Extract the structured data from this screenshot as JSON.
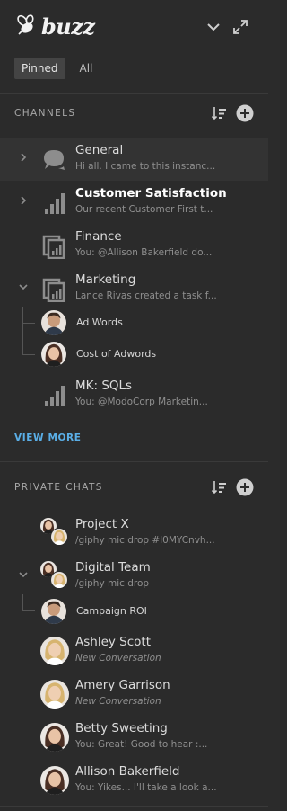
{
  "app": {
    "logo_text": "buzz"
  },
  "filters": {
    "pinned": "Pinned",
    "all": "All"
  },
  "channels": {
    "header": "CHANNELS",
    "items": [
      {
        "title": "General",
        "subtitle": "Hi all. I came to this instanc..."
      },
      {
        "title": "Customer Satisfaction",
        "subtitle": "Our recent Customer First t..."
      },
      {
        "title": "Finance",
        "subtitle": "You: @Allison Bakerfield do..."
      },
      {
        "title": "Marketing",
        "subtitle": "Lance Rivas created a task f..."
      },
      {
        "title": "MK: SQLs",
        "subtitle": "You: @ModoCorp Marketin..."
      }
    ],
    "marketing_children": [
      {
        "title": "Ad Words"
      },
      {
        "title": "Cost of Adwords"
      }
    ],
    "view_more": "VIEW MORE"
  },
  "private_chats": {
    "header": "PRIVATE CHATS",
    "items": [
      {
        "title": "Project X",
        "subtitle": "/giphy mic drop #l0MYCnvh..."
      },
      {
        "title": "Digital Team",
        "subtitle": "/giphy mic drop"
      },
      {
        "title": "Ashley Scott",
        "subtitle": "New Conversation"
      },
      {
        "title": "Amery Garrison",
        "subtitle": "New Conversation"
      },
      {
        "title": "Betty Sweeting",
        "subtitle": "You: Great! Good to hear :..."
      },
      {
        "title": "Allison Bakerfield",
        "subtitle": "You: Yikes... I'll take a look a..."
      }
    ],
    "digital_team_children": [
      {
        "title": "Campaign ROI"
      }
    ]
  },
  "colors": {
    "background": "#2b2b2b",
    "accent_link": "#5aaee6",
    "highlight_row": "#333333"
  }
}
